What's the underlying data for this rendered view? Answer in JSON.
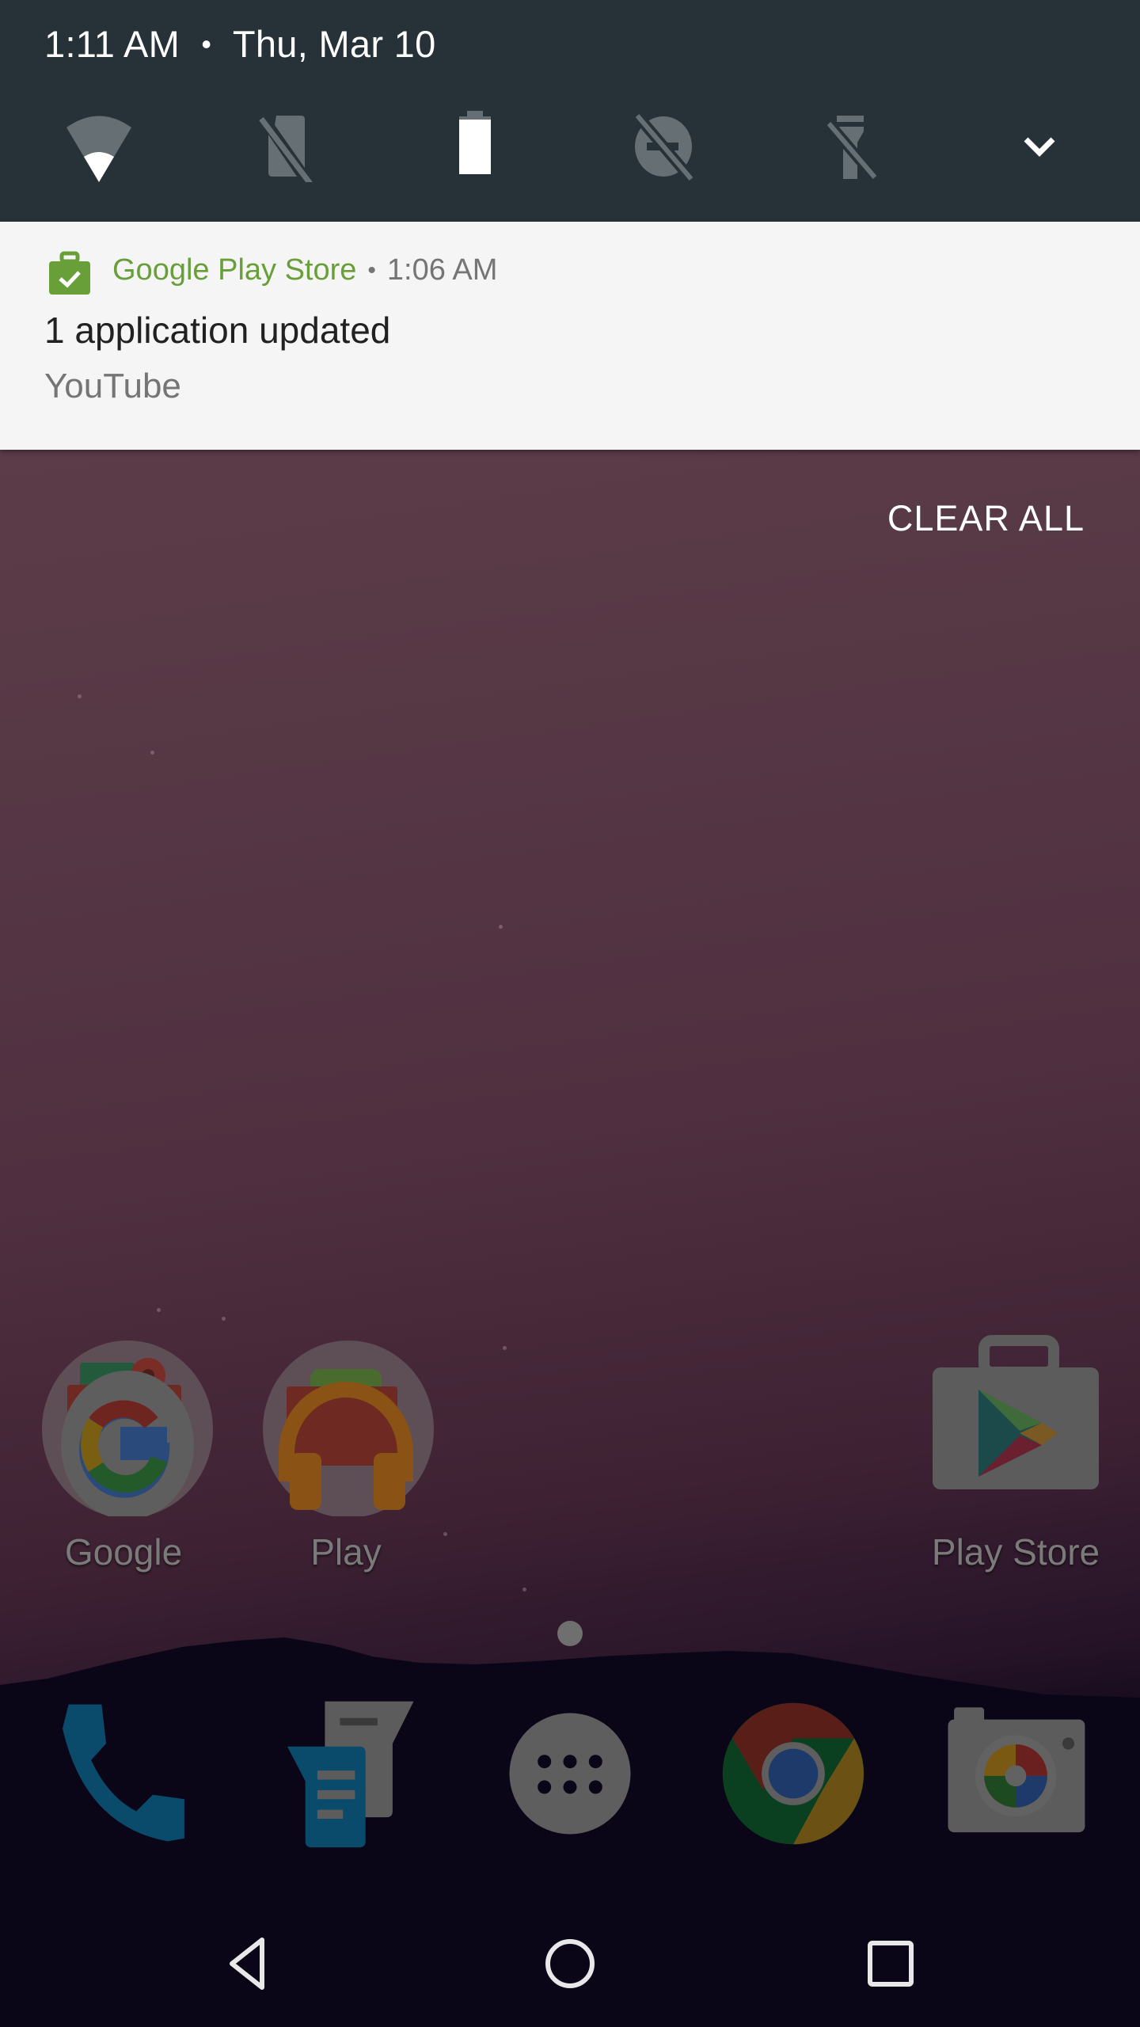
{
  "status": {
    "time": "1:11 AM",
    "separator": "•",
    "date": "Thu, Mar 10"
  },
  "quick_settings": {
    "tiles": [
      {
        "name": "wifi",
        "icon": "wifi-icon",
        "state": "connected-low-signal"
      },
      {
        "name": "mobile-data",
        "icon": "no-sim-icon",
        "state": "no-sim"
      },
      {
        "name": "battery",
        "icon": "battery-icon",
        "state": "full"
      },
      {
        "name": "do-not-disturb",
        "icon": "dnd-off-icon",
        "state": "off"
      },
      {
        "name": "flashlight",
        "icon": "flashlight-off-icon",
        "state": "off"
      }
    ],
    "expand_icon": "chevron-down-icon"
  },
  "notification": {
    "app_name": "Google Play Store",
    "separator": "•",
    "time": "1:06 AM",
    "title": "1 application updated",
    "text": "YouTube",
    "icon": "play-store-updated-icon",
    "accent_color": "#689f38"
  },
  "clear_all_label": "CLEAR ALL",
  "home_apps": [
    {
      "label": "Google",
      "icon": "google-folder-icon"
    },
    {
      "label": "Play",
      "icon": "play-folder-icon"
    },
    {
      "label": "Play Store",
      "icon": "play-store-icon"
    }
  ],
  "page_indicator": {
    "pages": 1,
    "current": 1
  },
  "dock": [
    {
      "name": "Phone",
      "icon": "phone-icon"
    },
    {
      "name": "Messages",
      "icon": "messages-icon"
    },
    {
      "name": "All apps",
      "icon": "app-drawer-icon"
    },
    {
      "name": "Chrome",
      "icon": "chrome-icon"
    },
    {
      "name": "Camera",
      "icon": "camera-icon"
    }
  ],
  "navigation": [
    {
      "name": "Back",
      "icon": "back-icon"
    },
    {
      "name": "Home",
      "icon": "home-icon"
    },
    {
      "name": "Recents",
      "icon": "recents-icon"
    }
  ],
  "colors": {
    "header_bg": "#263238",
    "notification_bg": "#f5f5f5",
    "icon_inactive": "#666f73",
    "icon_active": "#ffffff"
  }
}
